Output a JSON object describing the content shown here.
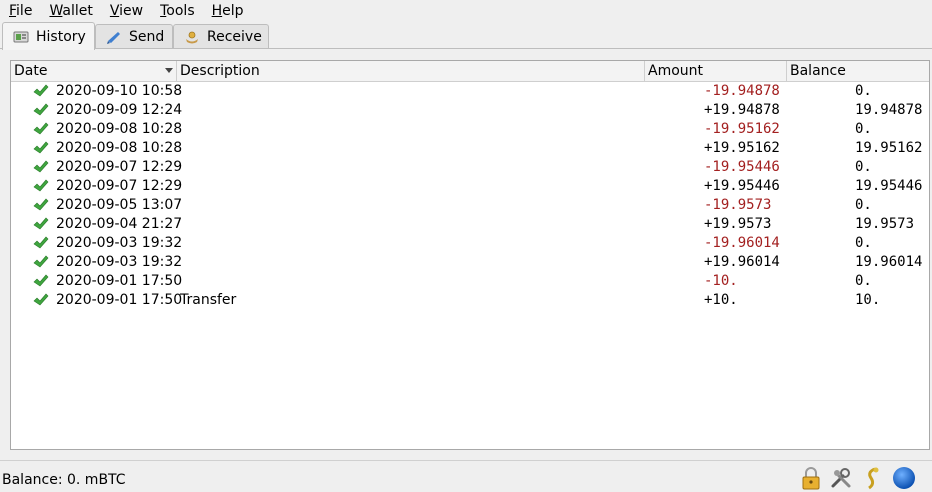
{
  "menu": [
    {
      "mnemonic": "F",
      "rest": "ile"
    },
    {
      "mnemonic": "W",
      "rest": "allet"
    },
    {
      "mnemonic": "V",
      "rest": "iew"
    },
    {
      "mnemonic": "T",
      "rest": "ools"
    },
    {
      "mnemonic": "H",
      "rest": "elp"
    }
  ],
  "tabs": {
    "history": "History",
    "send": "Send",
    "receive": "Receive"
  },
  "columns": {
    "date": "Date",
    "description": "Description",
    "amount": "Amount",
    "balance": "Balance"
  },
  "rows": [
    {
      "date": "2020-09-10 10:58",
      "description": "",
      "amount": "-19.94878",
      "balance": "0."
    },
    {
      "date": "2020-09-09 12:24",
      "description": "",
      "amount": "+19.94878",
      "balance": "19.94878"
    },
    {
      "date": "2020-09-08 10:28",
      "description": "",
      "amount": "-19.95162",
      "balance": "0."
    },
    {
      "date": "2020-09-08 10:28",
      "description": "",
      "amount": "+19.95162",
      "balance": "19.95162"
    },
    {
      "date": "2020-09-07 12:29",
      "description": "",
      "amount": "-19.95446",
      "balance": "0."
    },
    {
      "date": "2020-09-07 12:29",
      "description": "",
      "amount": "+19.95446",
      "balance": "19.95446"
    },
    {
      "date": "2020-09-05 13:07",
      "description": "",
      "amount": "-19.9573",
      "balance": "0."
    },
    {
      "date": "2020-09-04 21:27",
      "description": "",
      "amount": "+19.9573",
      "balance": "19.9573"
    },
    {
      "date": "2020-09-03 19:32",
      "description": "",
      "amount": "-19.96014",
      "balance": "0."
    },
    {
      "date": "2020-09-03 19:32",
      "description": "",
      "amount": "+19.96014",
      "balance": "19.96014"
    },
    {
      "date": "2020-09-01 17:50",
      "description": "",
      "amount": "-10.",
      "balance": "0."
    },
    {
      "date": "2020-09-01 17:50",
      "description": "Transfer",
      "amount": "+10.",
      "balance": "10."
    }
  ],
  "colors": {
    "negative": "#a32020",
    "positive": "#000000",
    "check": "#3fa63f"
  },
  "status": {
    "balance": "Balance: 0. mBTC",
    "icons": [
      "lock-icon",
      "preferences-icon",
      "seed-icon",
      "network-status-icon"
    ]
  }
}
